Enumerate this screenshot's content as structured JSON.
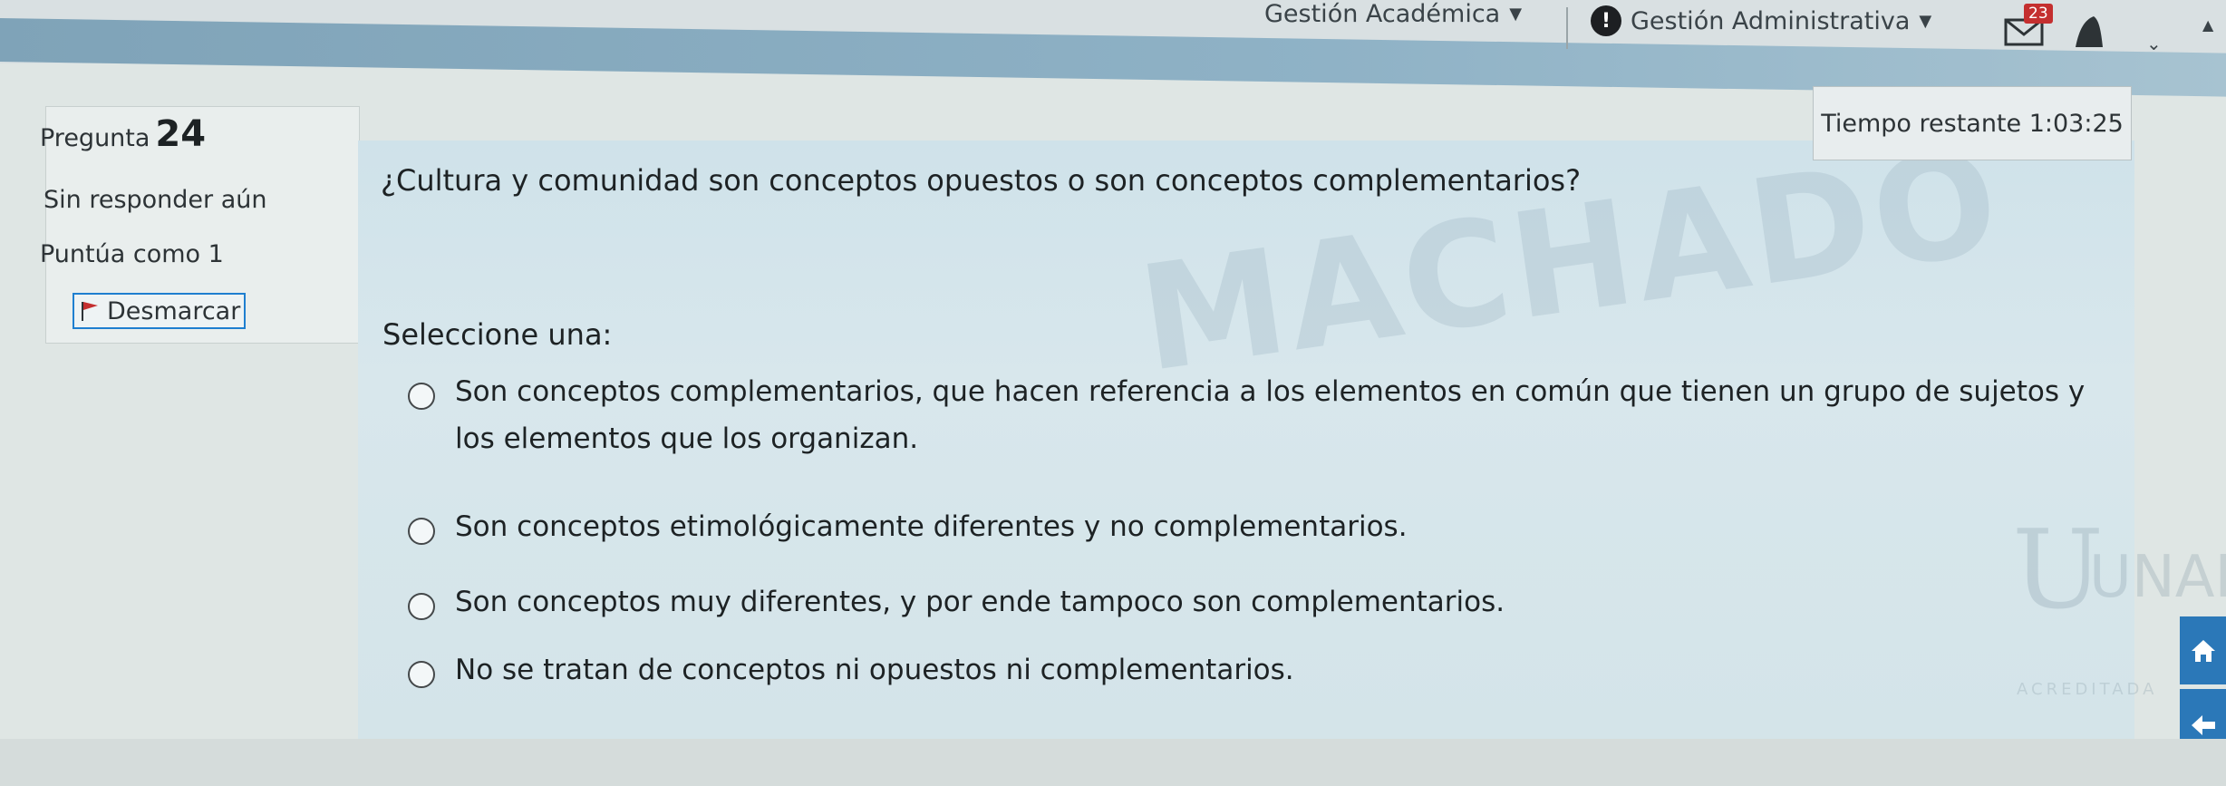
{
  "nav": {
    "academica": "Gestión Académica",
    "admin": "Gestión Administrativa",
    "notification_count": "23"
  },
  "info": {
    "label": "Pregunta",
    "number": "24",
    "status": "Sin responder aún",
    "points": "Puntúa como 1",
    "flag": "Desmarcar"
  },
  "timer": "Tiempo restante 1:03:25",
  "question": {
    "text": "¿Cultura y comunidad son conceptos opuestos  o son conceptos complementarios?",
    "prompt": "Seleccione una:",
    "options": [
      "Son conceptos complementarios, que hacen referencia a los elementos en común que tienen un grupo de sujetos y los elementos que los organizan.",
      "Son conceptos etimológicamente diferentes y no complementarios.",
      "Son conceptos muy diferentes, y por ende tampoco son complementarios.",
      "No se tratan de conceptos ni opuestos ni complementarios."
    ]
  },
  "watermark": "MACHADO",
  "logo": {
    "mark": "UNAD",
    "caption": "ACREDITADA"
  },
  "colors": {
    "accent": "#1f7fd0",
    "panel": "#d4e4e9",
    "flag": "#c42f2f"
  }
}
